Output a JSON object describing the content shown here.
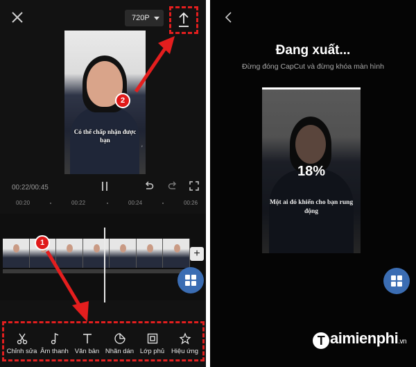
{
  "left": {
    "resolution": "720P",
    "video_caption": "Có thể chấp nhận được bạn",
    "time_current": "00:22",
    "time_total": "00:45",
    "ruler_ticks": [
      "00:20",
      "00:22",
      "00:24",
      "00:26"
    ],
    "annotation_1": "1",
    "annotation_2": "2",
    "toolbar": [
      {
        "label": "Chỉnh sửa",
        "icon": "scissors-icon"
      },
      {
        "label": "Âm thanh",
        "icon": "music-note-icon"
      },
      {
        "label": "Văn bản",
        "icon": "text-icon"
      },
      {
        "label": "Nhãn dán",
        "icon": "sticker-icon"
      },
      {
        "label": "Lớp phủ",
        "icon": "overlay-icon"
      },
      {
        "label": "Hiệu ứng",
        "icon": "effects-icon"
      }
    ]
  },
  "right": {
    "title": "Đang xuất...",
    "subtitle": "Đừng đóng CapCut và đừng khóa màn hình",
    "progress_percent": "18%",
    "video_caption": "Một ai đó khiến cho bạn rung động"
  },
  "brand": {
    "letter": "T",
    "name": "aimienphi",
    "suffix": ".vn"
  },
  "colors": {
    "accent_red": "#e41e1e",
    "grid_button_blue": "#3b6db3"
  }
}
